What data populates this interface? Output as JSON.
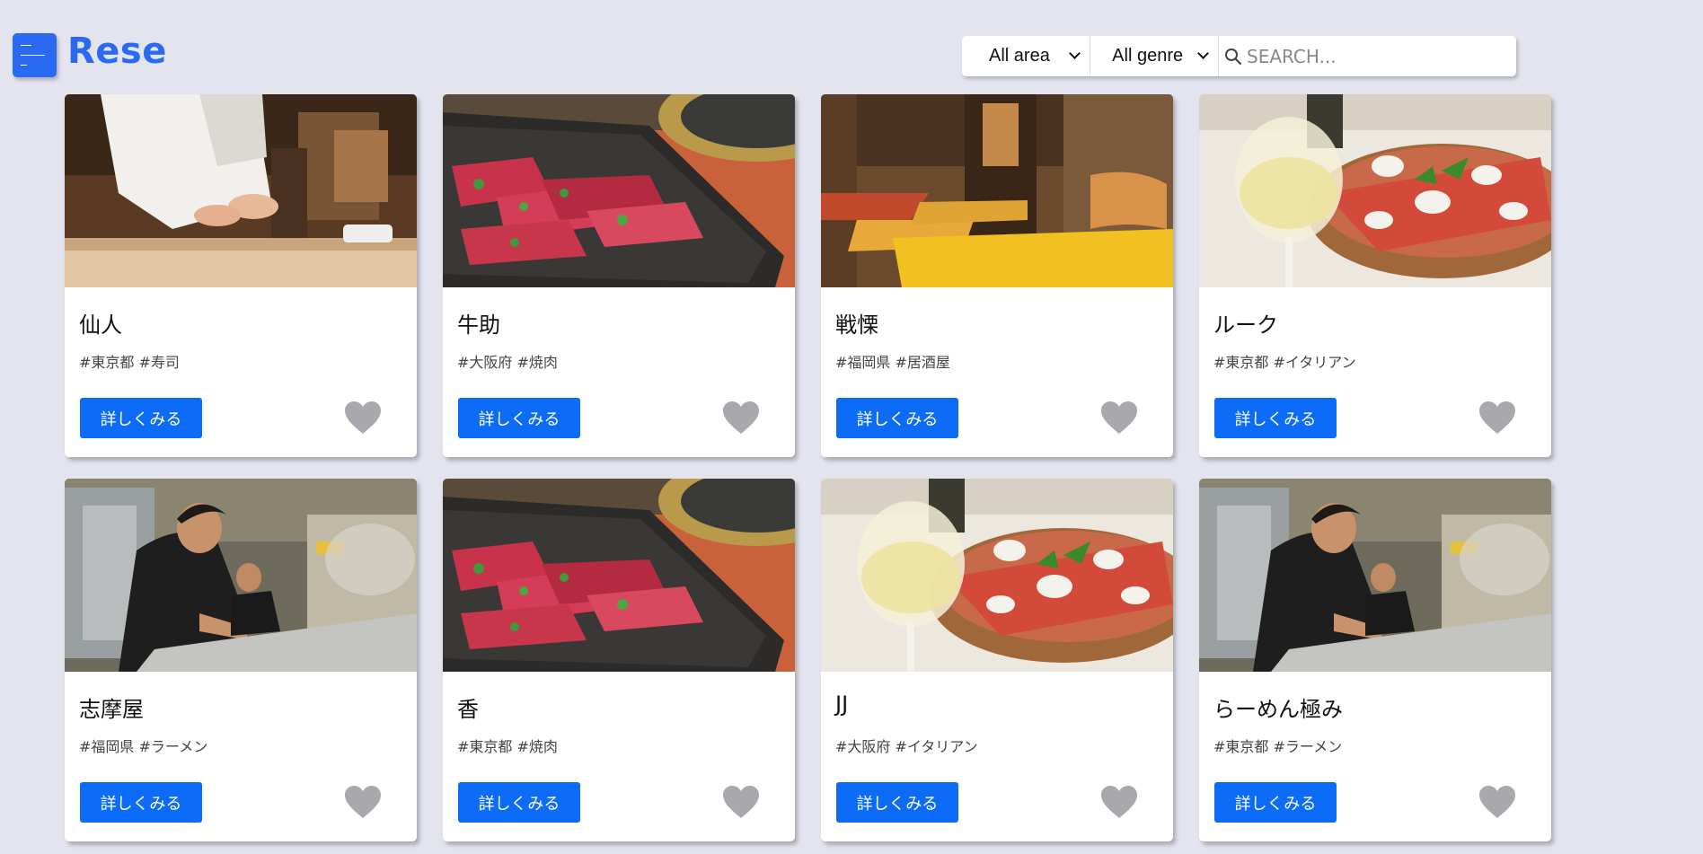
{
  "header": {
    "title": "Rese",
    "menu_icon": "hamburger-menu-icon",
    "accent_color": "#2a6af2"
  },
  "search": {
    "area_selected": "All area",
    "genre_selected": "All genre",
    "placeholder": "SEARCH...",
    "icon": "search-icon"
  },
  "card_common": {
    "detail_label": "詳しくみる",
    "favorite_icon": "heart-icon",
    "button_color": "#0d6cf7",
    "heart_color": "#a9a9ad"
  },
  "shops": [
    {
      "name": "仙人",
      "tags": "#東京都 #寿司",
      "image": "sushi-chef-photo"
    },
    {
      "name": "牛助",
      "tags": "#大阪府 #焼肉",
      "image": "yakiniku-beef-photo"
    },
    {
      "name": "戦慄",
      "tags": "#福岡県 #居酒屋",
      "image": "izakaya-interior-photo"
    },
    {
      "name": "ルーク",
      "tags": "#東京都 #イタリアン",
      "image": "pizza-wine-photo"
    },
    {
      "name": "志摩屋",
      "tags": "#福岡県 #ラーメン",
      "image": "ramen-kitchen-photo"
    },
    {
      "name": "香",
      "tags": "#東京都 #焼肉",
      "image": "yakiniku-beef-photo"
    },
    {
      "name": "JJ",
      "tags": "#大阪府 #イタリアン",
      "image": "pizza-wine-photo"
    },
    {
      "name": "らーめん極み",
      "tags": "#東京都 #ラーメン",
      "image": "ramen-kitchen-photo"
    }
  ]
}
